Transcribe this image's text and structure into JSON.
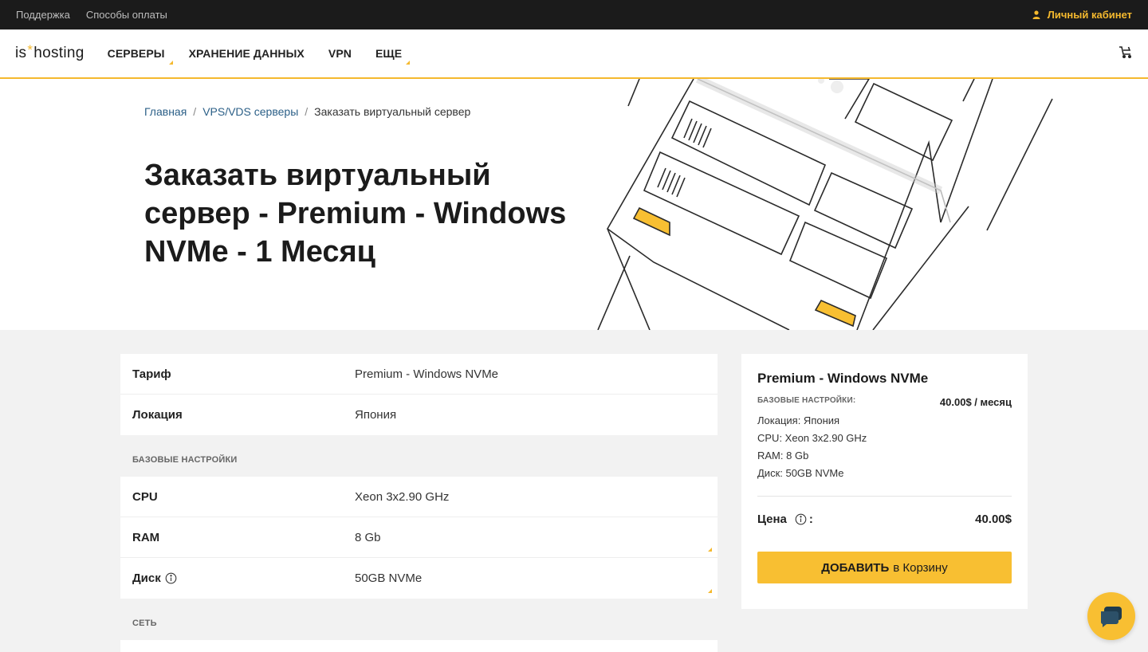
{
  "topbar": {
    "support": "Поддержка",
    "payment": "Способы оплаты",
    "account": "Личный кабинет"
  },
  "nav": {
    "logo_left": "is",
    "logo_star": "*",
    "logo_right": "hosting",
    "items": [
      "СЕРВЕРЫ",
      "ХРАНЕНИЕ ДАННЫХ",
      "VPN",
      "ЕЩЕ"
    ]
  },
  "breadcrumb": {
    "home": "Главная",
    "sep": "/",
    "vps": "VPS/VDS серверы",
    "current": "Заказать виртуальный сервер"
  },
  "hero": {
    "title": "Заказать виртуальный сервер - Premium - Windows NVMe - 1 Месяц"
  },
  "config": {
    "tariff_label": "Тариф",
    "tariff_value": "Premium - Windows NVMe",
    "location_label": "Локация",
    "location_value": "Япония",
    "base_section": "БАЗОВЫЕ НАСТРОЙКИ",
    "cpu_label": "CPU",
    "cpu_value": "Xeon 3x2.90 GHz",
    "ram_label": "RAM",
    "ram_value": "8 Gb",
    "disk_label": "Диск",
    "disk_value": "50GB NVMe",
    "network_section": "СЕТЬ"
  },
  "summary": {
    "title": "Premium - Windows NVMe",
    "base_label": "БАЗОВЫЕ НАСТРОЙКИ:",
    "base_price": "40.00$ / месяц",
    "specs": [
      "Локация: Япония",
      "CPU: Xeon 3x2.90 GHz",
      "RAM: 8 Gb",
      "Диск: 50GB NVMe"
    ],
    "price_label": "Цена",
    "price_colon": ":",
    "price_value": "40.00$",
    "add_bold": "ДОБАВИТЬ",
    "add_rest": "в Корзину"
  },
  "colors": {
    "accent": "#f8bf32",
    "topbar": "#1b1b1b",
    "link": "#2b5f87"
  },
  "icons": {
    "account": "user-icon",
    "cart": "cart-icon",
    "info": "info-icon",
    "chat": "chat-icon"
  }
}
